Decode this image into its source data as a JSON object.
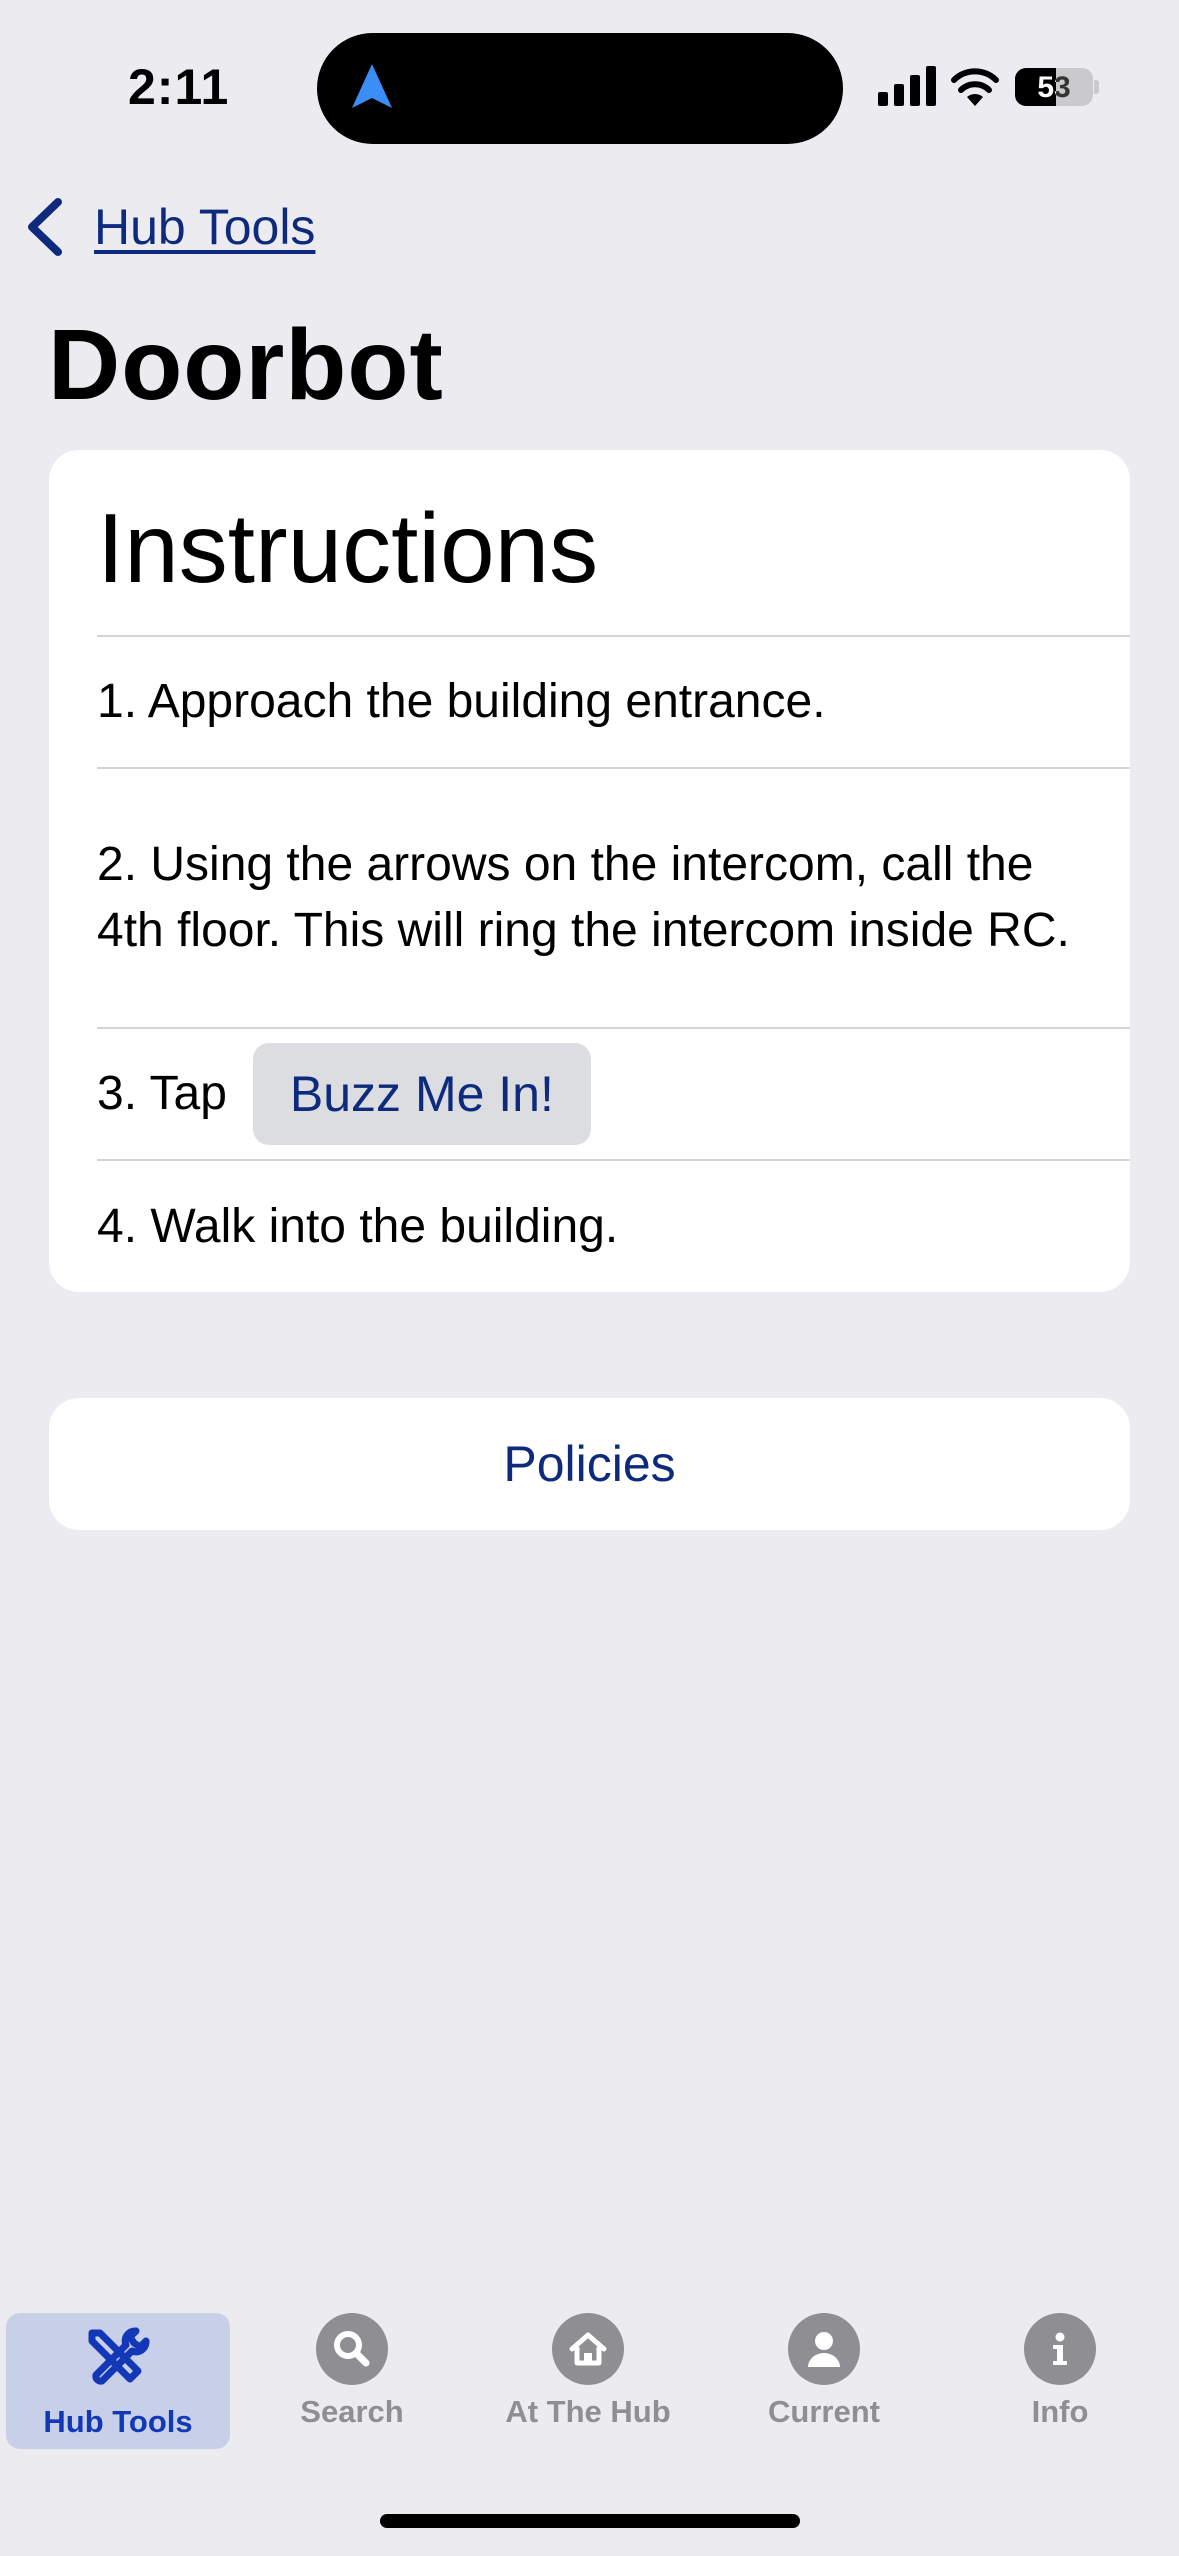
{
  "status_bar": {
    "time": "2:11",
    "battery": "53",
    "battery_level": 0.53
  },
  "nav": {
    "back_label": "Hub Tools",
    "title": "Doorbot"
  },
  "instructions": {
    "heading": "Instructions",
    "step1": "1. Approach the building entrance.",
    "step2": "2. Using the arrows on the intercom, call the 4th floor. This will ring the intercom inside RC.",
    "step3_prefix": "3. Tap",
    "step3_button": "Buzz Me In!",
    "step4": "4. Walk into the building."
  },
  "policies_label": "Policies",
  "tab_bar": {
    "tabs": [
      {
        "label": "Hub Tools",
        "icon": "tools-icon",
        "active": true
      },
      {
        "label": "Search",
        "icon": "search-icon",
        "active": false
      },
      {
        "label": "At The Hub",
        "icon": "home-icon",
        "active": false
      },
      {
        "label": "Current",
        "icon": "person-icon",
        "active": false
      },
      {
        "label": "Info",
        "icon": "info-icon",
        "active": false
      }
    ]
  },
  "colors": {
    "accent": "#0e2a7d",
    "tab_active": "#1238b8",
    "tab_inactive": "#8e8e93",
    "background": "#ebebf0"
  }
}
